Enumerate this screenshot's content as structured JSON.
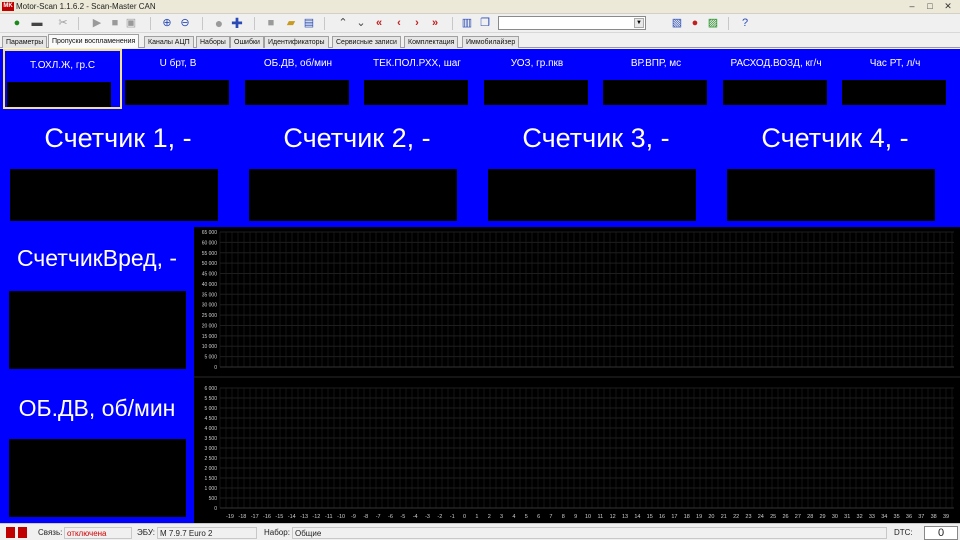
{
  "window": {
    "logo": "MK",
    "title": "Motor-Scan 1.1.6.2 - Scan-Master CAN",
    "minimize_icon": "‒",
    "maximize_icon": "□",
    "close_icon": "✕"
  },
  "toolbar": {
    "select_value": ""
  },
  "tabs": [
    {
      "label": "Параметры",
      "active": false
    },
    {
      "label": "Пропуски воспламенения",
      "active": true
    },
    {
      "label": "Каналы АЦП",
      "active": false
    },
    {
      "label": "Наборы",
      "active": false
    },
    {
      "label": "Ошибки",
      "active": false
    },
    {
      "label": "Идентификаторы",
      "active": false
    },
    {
      "label": "Сервисные записи",
      "active": false
    },
    {
      "label": "Комплектация",
      "active": false
    },
    {
      "label": "Иммобилайзер",
      "active": false
    }
  ],
  "params": [
    {
      "label": "Т.ОХЛ.Ж, гр.С",
      "value": ""
    },
    {
      "label": "U брт, В",
      "value": ""
    },
    {
      "label": "ОБ.ДВ, об/мин",
      "value": ""
    },
    {
      "label": "ТЕК.ПОЛ.РХХ, шаг",
      "value": ""
    },
    {
      "label": "УОЗ, гр.пкв",
      "value": ""
    },
    {
      "label": "ВР.ВПР, мс",
      "value": ""
    },
    {
      "label": "РАСХОД.ВОЗД, кг/ч",
      "value": ""
    },
    {
      "label": "Час РТ, л/ч",
      "value": ""
    }
  ],
  "counters": [
    {
      "label": "Счетчик 1, -",
      "value": ""
    },
    {
      "label": "Счетчик 2, -",
      "value": ""
    },
    {
      "label": "Счетчик 3, -",
      "value": ""
    },
    {
      "label": "Счетчик 4, -",
      "value": ""
    }
  ],
  "side_panels": [
    {
      "label": "СчетчикВред, -",
      "value": ""
    },
    {
      "label": "ОБ.ДВ, об/мин",
      "value": ""
    }
  ],
  "chart_data": [
    {
      "type": "line",
      "title": "",
      "xlabel": "",
      "ylabel": "",
      "ylim": [
        0,
        65000
      ],
      "yticks": [
        "65 000",
        "60 000",
        "55 000",
        "50 000",
        "45 000",
        "40 000",
        "35 000",
        "30 000",
        "25 000",
        "20 000",
        "15 000",
        "10 000",
        "5 000",
        "0"
      ],
      "series": []
    },
    {
      "type": "line",
      "title": "",
      "xlabel": "",
      "ylabel": "",
      "ylim": [
        0,
        6000
      ],
      "yticks": [
        "6 000",
        "5 500",
        "5 000",
        "4 500",
        "4 000",
        "3 500",
        "3 000",
        "2 500",
        "2 000",
        "1 500",
        "1 000",
        "500",
        "0"
      ],
      "xlim": [
        -19,
        39
      ],
      "xticks": [
        -19,
        -18,
        -17,
        -16,
        -15,
        -14,
        -13,
        -12,
        -11,
        -10,
        -9,
        -8,
        -7,
        -6,
        -5,
        -4,
        -3,
        -2,
        -1,
        0,
        1,
        2,
        3,
        4,
        5,
        6,
        7,
        8,
        9,
        10,
        11,
        12,
        13,
        14,
        15,
        16,
        17,
        18,
        19,
        20,
        21,
        22,
        23,
        24,
        25,
        26,
        27,
        28,
        29,
        30,
        31,
        32,
        33,
        34,
        35,
        36,
        37,
        38,
        39
      ],
      "series": []
    }
  ],
  "status": {
    "connection_label": "Связь:",
    "connection_value": "отключена",
    "ecu_label": "ЭБУ:",
    "ecu_value": "M 7.9.7 Euro 2",
    "set_label": "Набор:",
    "set_value": "Общие",
    "dtc_label": "DTC:",
    "dtc_value": "0"
  },
  "colors": {
    "main_bg": "#0000ff",
    "value_box": "#000000",
    "selected_border": "#f2e08a",
    "status_disconnected": "#d00000"
  }
}
